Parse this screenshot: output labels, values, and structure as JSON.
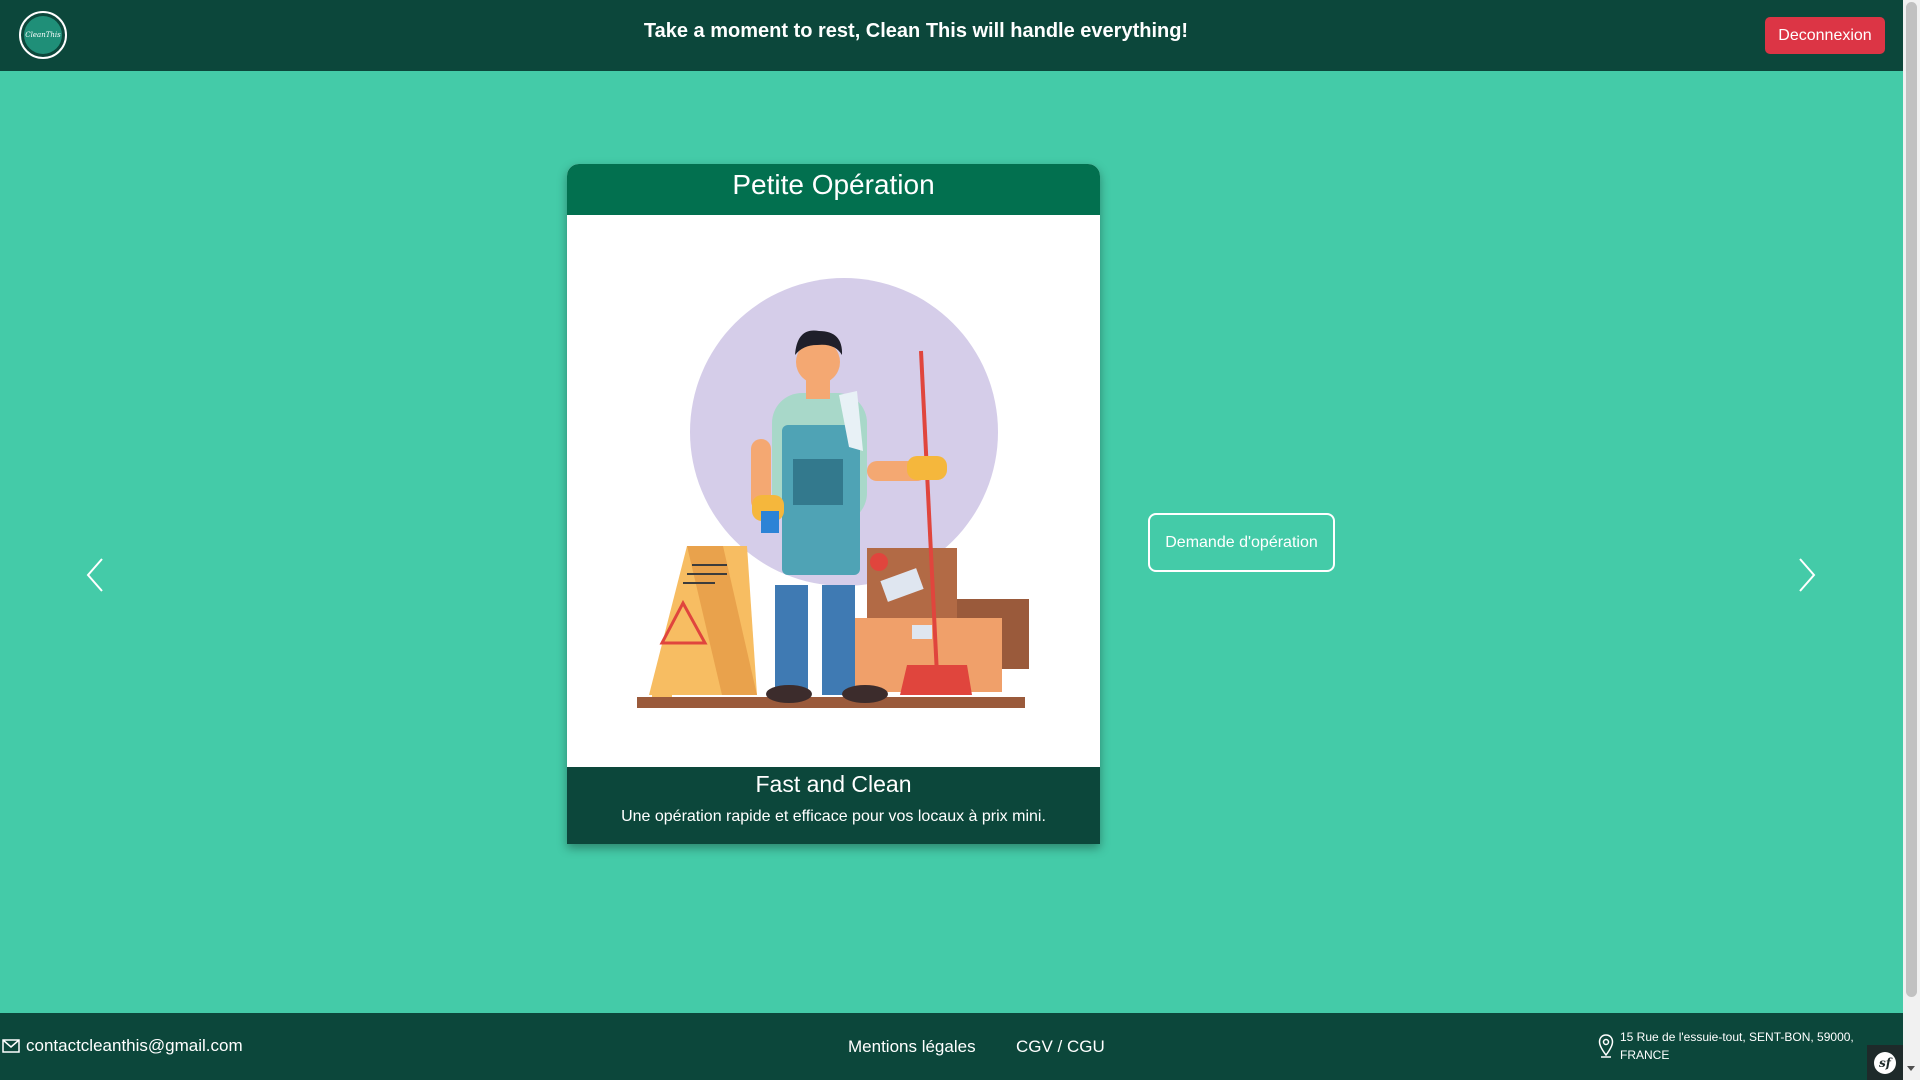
{
  "header": {
    "logo_text": "CleanThis",
    "tagline": "Take a moment to rest, Clean This will handle everything!",
    "logout_label": "Deconnexion"
  },
  "carousel": {
    "card": {
      "title": "Petite Opération",
      "subtitle": "Fast and Clean",
      "description": "Une opération rapide et efficace pour vos locaux à prix mini."
    },
    "prev_icon": "chevron-left-icon",
    "next_icon": "chevron-right-icon"
  },
  "demand_button_label": "Demande d'opération",
  "footer": {
    "email": "contactcleanthis@gmail.com",
    "legal_label": "Mentions légales",
    "cgv_label": "CGV / CGU",
    "address": "15 Rue de l'essuie-tout, SENT-BON, 59000, FRANCE"
  },
  "colors": {
    "background": "#44cba8",
    "header": "#0c473b",
    "card_title": "#02704f",
    "logout": "#dc3545"
  }
}
